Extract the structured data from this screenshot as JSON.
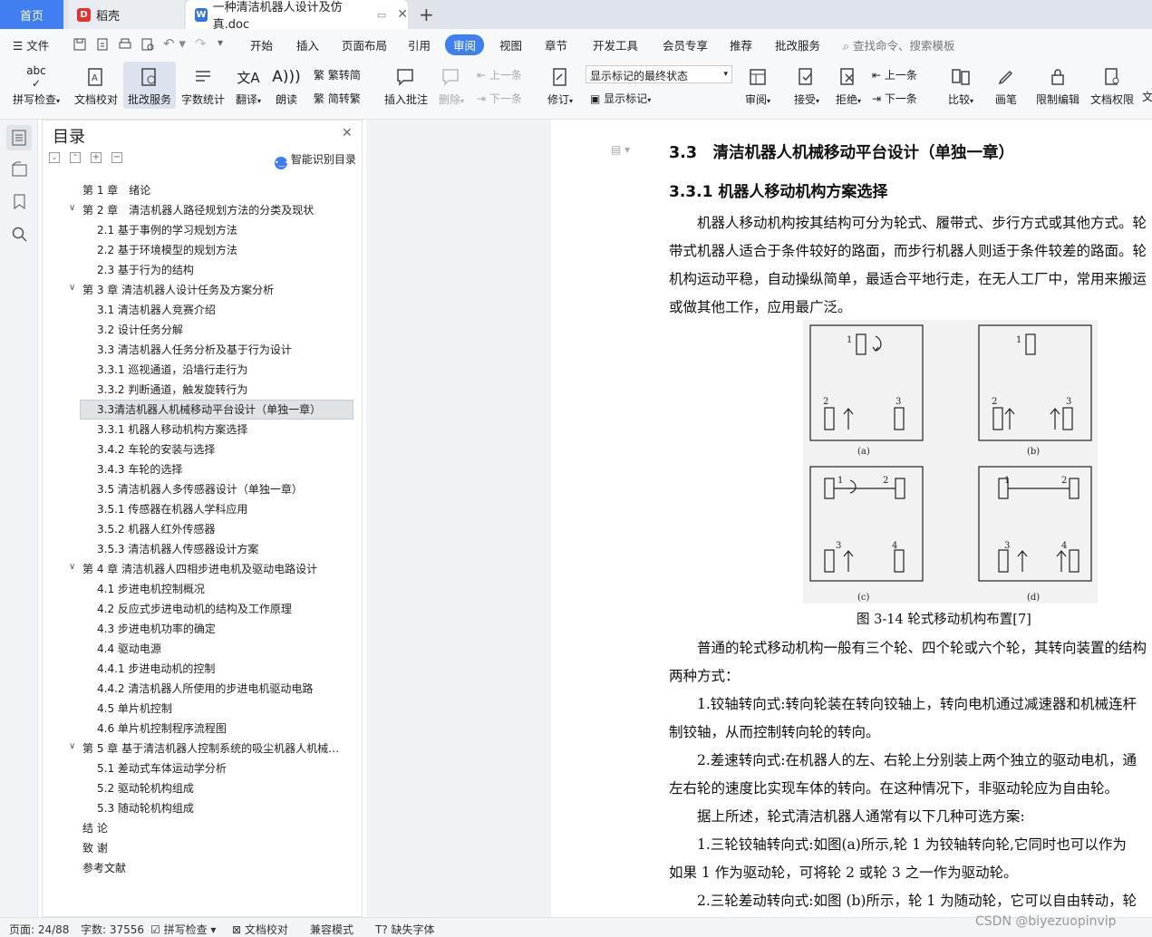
{
  "tabs": {
    "home": "首页",
    "daoke": "稻壳",
    "doc": "一种清洁机器人设计及仿真.doc"
  },
  "menu": {
    "file": "文件",
    "items": [
      "开始",
      "插入",
      "页面布局",
      "引用",
      "审阅",
      "视图",
      "章节",
      "开发工具",
      "会员专享",
      "推荐",
      "批改服务"
    ],
    "active": "审阅",
    "search": "查找命令、搜索模板"
  },
  "ribbon": {
    "spell": "拼写检查",
    "proof": "文档校对",
    "correct": "批改服务",
    "wordcount": "字数统计",
    "translate": "翻译",
    "read": "朗读",
    "trad": "繁转简",
    "simp": "简转繁",
    "insert_comment": "插入批注",
    "delete": "删除",
    "prev": "上一条",
    "next": "下一条",
    "track": "修订",
    "markup_state": "显示标记的最终状态",
    "show_markup": "显示标记",
    "review": "审阅",
    "accept": "接受",
    "reject": "拒绝",
    "prev2": "上一条",
    "next2": "下一条",
    "compare": "比较",
    "pen": "画笔",
    "restrict": "限制编辑",
    "permission": "文档权限",
    "more": "文"
  },
  "nav": {
    "title": "目录",
    "smart": "智能识别目录",
    "items": [
      {
        "t": "第 1 章　绪论",
        "lvl": 1,
        "chev": false
      },
      {
        "t": "第 2 章　清洁机器人路径规划方法的分类及现状",
        "lvl": 1,
        "chev": true
      },
      {
        "t": "2.1  基于事例的学习规划方法",
        "lvl": 2
      },
      {
        "t": "2.2  基于环境模型的规划方法",
        "lvl": 2
      },
      {
        "t": "2.3  基于行为的结构",
        "lvl": 2
      },
      {
        "t": "第 3 章  清洁机器人设计任务及方案分析",
        "lvl": 1,
        "chev": true
      },
      {
        "t": "3.1  清洁机器人竞赛介绍",
        "lvl": 2
      },
      {
        "t": "3.2  设计任务分解",
        "lvl": 2
      },
      {
        "t": "3.3  清洁机器人任务分析及基于行为设计",
        "lvl": 2
      },
      {
        "t": "3.3.1  巡视通道，沿墙行走行为",
        "lvl": 2
      },
      {
        "t": "3.3.2  判断通道，触发旋转行为",
        "lvl": 2
      },
      {
        "t": "3.3清洁机器人机械移动平台设计（单独一章）",
        "lvl": 2,
        "sel": true
      },
      {
        "t": "3.3.1  机器人移动机构方案选择",
        "lvl": 2
      },
      {
        "t": "3.4.2  车轮的安装与选择",
        "lvl": 2
      },
      {
        "t": "3.4.3  车轮的选择",
        "lvl": 2
      },
      {
        "t": "3.5  清洁机器人多传感器设计（单独一章）",
        "lvl": 2
      },
      {
        "t": "3.5.1  传感器在机器人学科应用",
        "lvl": 2
      },
      {
        "t": "3.5.2  机器人红外传感器",
        "lvl": 2
      },
      {
        "t": "3.5.3 清洁机器人传感器设计方案",
        "lvl": 2
      },
      {
        "t": "第 4 章  清洁机器人四相步进电机及驱动电路设计",
        "lvl": 1,
        "chev": true
      },
      {
        "t": "4.1  步进电机控制概况",
        "lvl": 2
      },
      {
        "t": "4.2  反应式步进电动机的结构及工作原理",
        "lvl": 2
      },
      {
        "t": "4.3  步进电机功率的确定",
        "lvl": 2
      },
      {
        "t": "4.4  驱动电源",
        "lvl": 2
      },
      {
        "t": "4.4.1  步进电动机的控制",
        "lvl": 2
      },
      {
        "t": "4.4.2  清洁机器人所使用的步进电机驱动电路",
        "lvl": 2
      },
      {
        "t": "4.5  单片机控制",
        "lvl": 2
      },
      {
        "t": "4.6  单片机控制程序流程图",
        "lvl": 2
      },
      {
        "t": "第 5 章  基于清洁机器人控制系统的吸尘机器人机械…",
        "lvl": 1,
        "chev": true
      },
      {
        "t": "5.1 差动式车体运动学分析",
        "lvl": 2
      },
      {
        "t": "5.2  驱动轮机构组成",
        "lvl": 2
      },
      {
        "t": "5.3  随动轮机构组成",
        "lvl": 2
      },
      {
        "t": "结  论",
        "lvl": 1,
        "chev": false
      },
      {
        "t": "致  谢",
        "lvl": 1,
        "chev": false
      },
      {
        "t": "参考文献",
        "lvl": 1,
        "chev": false
      }
    ]
  },
  "doc": {
    "h1": "3.3　清洁机器人机械移动平台设计（单独一章）",
    "h2": "3.3.1 机器人移动机构方案选择",
    "p1": [
      "　　机器人移动机构按其结构可分为轮式、履带式、步行方式或其他方式。轮",
      "带式机器人适合于条件较好的路面，而步行机器人则适于条件较差的路面。轮",
      "机构运动平稳，自动操纵简单，最适合平地行走，在无人工厂中，常用来搬运",
      "或做其他工作，应用最广泛。"
    ],
    "fig_labels": [
      "(a)",
      "(b)",
      "(c)",
      "(d)"
    ],
    "fig_nums": [
      "1",
      "2",
      "3",
      "4"
    ],
    "caption": "图 3-14 轮式移动机构布置[7]",
    "p2": [
      "　　普通的轮式移动机构一般有三个轮、四个轮或六个轮，其转向装置的结构",
      "两种方式：",
      "　　1.铰轴转向式:转向轮装在转向铰轴上，转向电机通过减速器和机械连杆",
      "制铰轴，从而控制转向轮的转向。",
      "　　2.差速转向式:在机器人的左、右轮上分别装上两个独立的驱动电机，通",
      "左右轮的速度比实现车体的转向。在这种情况下，非驱动轮应为自由轮。",
      "　　据上所述，轮式清洁机器人通常有以下几种可选方案:",
      "　　1.三轮铰轴转向式:如图(a)所示,轮 1 为铰轴转向轮,它同时也可以作为",
      "如果 1 作为驱动轮，可将轮 2 或轮 3 之一作为驱动轮。",
      "　　2.三轮差动转向式:如图 (b)所示，轮 1 为随动轮，它可以自由转动，轮"
    ]
  },
  "status": {
    "page": "页面: 24/88",
    "words": "字数: 37556",
    "spell": "拼写检查",
    "proof": "文档校对",
    "compat": "兼容模式",
    "font": "缺失字体",
    "watermark": "CSDN @biyezuopinvip"
  }
}
